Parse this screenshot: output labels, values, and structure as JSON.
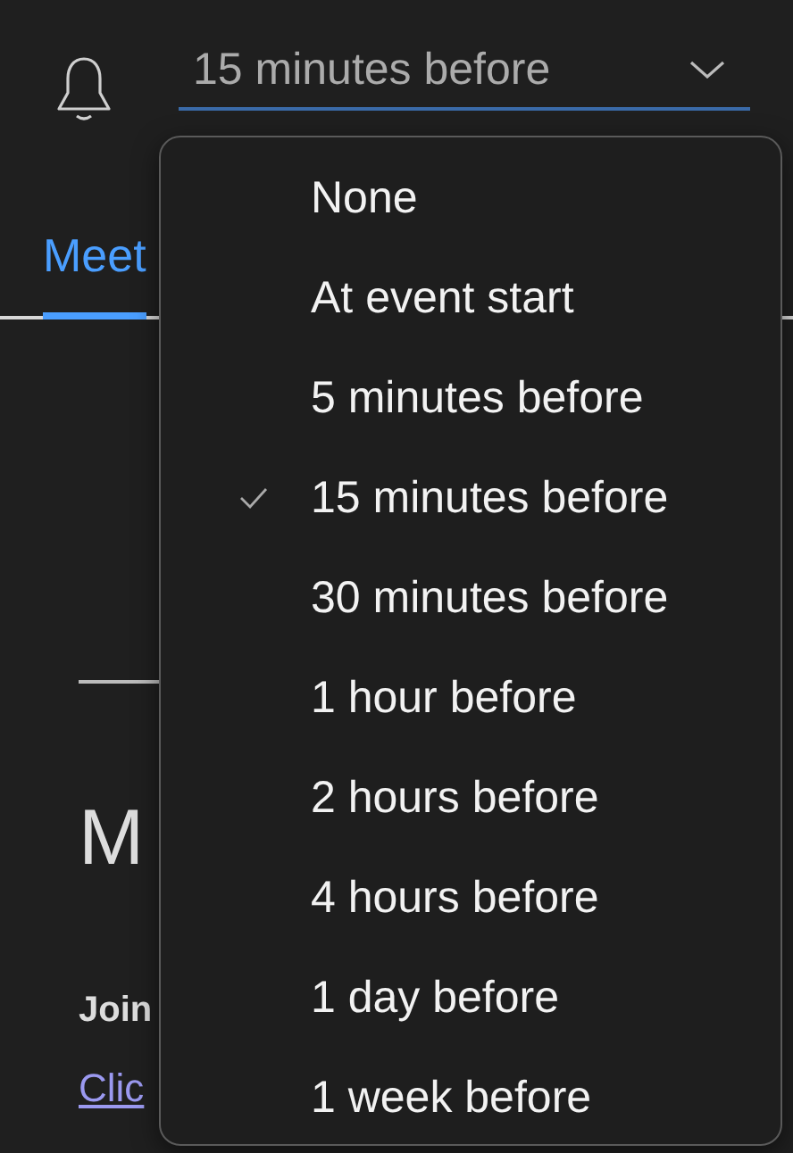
{
  "reminder": {
    "value": "15 minutes before"
  },
  "tabs": [
    {
      "label": "Meet",
      "selected": true
    }
  ],
  "content": {
    "heading": "M",
    "label": "Join",
    "link": "Clic"
  },
  "dropdown": {
    "options": [
      {
        "label": "None",
        "selected": false
      },
      {
        "label": "At event start",
        "selected": false
      },
      {
        "label": "5 minutes before",
        "selected": false
      },
      {
        "label": "15 minutes before",
        "selected": true
      },
      {
        "label": "30 minutes before",
        "selected": false
      },
      {
        "label": "1 hour before",
        "selected": false
      },
      {
        "label": "2 hours before",
        "selected": false
      },
      {
        "label": "4 hours before",
        "selected": false
      },
      {
        "label": "1 day before",
        "selected": false
      },
      {
        "label": "1 week before",
        "selected": false
      }
    ]
  }
}
